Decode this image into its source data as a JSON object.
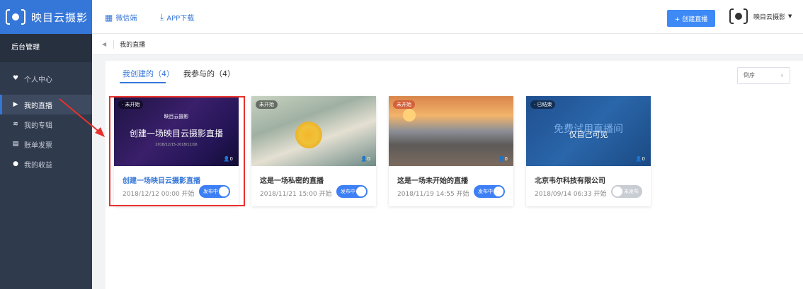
{
  "brand": {
    "name": "映目云摄影"
  },
  "sidebar": {
    "section_label": "后台管理",
    "items": [
      {
        "label": "个人中心",
        "icon": "heart-icon"
      },
      {
        "label": "我的直播",
        "icon": "play-icon"
      },
      {
        "label": "我的专辑",
        "icon": "album-icon"
      },
      {
        "label": "账单发票",
        "icon": "invoice-icon"
      },
      {
        "label": "我的收益",
        "icon": "income-icon"
      }
    ]
  },
  "topbar": {
    "wechat_label": "微信端",
    "app_download_label": "APP下载",
    "create_button": "+ 创建直播",
    "username": "映目云摄影"
  },
  "breadcrumb": {
    "current": "我的直播"
  },
  "tabs": [
    {
      "label": "我创建的（4）"
    },
    {
      "label": "我参与的（4）"
    }
  ],
  "sort": {
    "selected": "倒序"
  },
  "cards": [
    {
      "status": "· 未开始",
      "count": "0",
      "title": "创建一场映目云摄影直播",
      "date": "2018/12/12 00:00 开始",
      "toggle": "发布中",
      "inner_title": "创建一场映目云摄影直播",
      "inner_logo": "映目云摄影",
      "inner_date": "2018/12/15-2018/12/16"
    },
    {
      "status": "未开始",
      "count": "0",
      "title": "这是一场私密的直播",
      "date": "2018/11/21 15:00 开始",
      "toggle": "发布中"
    },
    {
      "status": "未开始",
      "count": "0",
      "title": "这是一场未开始的直播",
      "date": "2018/11/19 14:55 开始",
      "toggle": "发布中"
    },
    {
      "status": "· 已结束",
      "count": "0",
      "title": "北京韦尔科技有限公司",
      "date": "2018/09/14 06:33 开始",
      "toggle": "未发布",
      "inner_title": "免费试用直播间",
      "overlay": "仅自己可见"
    }
  ],
  "colors": {
    "brand_blue": "#3576d9",
    "sidebar_bg": "#2f3a4c",
    "highlight_red": "#e8312c"
  }
}
